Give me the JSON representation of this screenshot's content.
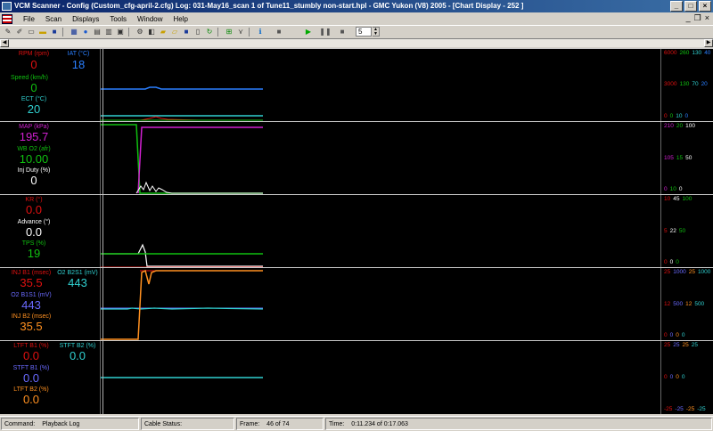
{
  "window": {
    "title": "VCM Scanner - Config (Custom_cfg-april-2.cfg) Log: 031-May16_scan 1 of Tune11_stumbly non-start.hpl - GMC Yukon (V8) 2005 - [Chart Display - 252 ]",
    "minimize": "_",
    "maximize": "□",
    "close": "×"
  },
  "menu": {
    "items": [
      "File",
      "Scan",
      "Displays",
      "Tools",
      "Window",
      "Help"
    ],
    "mdi_minimize": "_",
    "mdi_restore": "❐",
    "mdi_close": "×"
  },
  "toolbar": {
    "playback_speed": "5"
  },
  "panels": [
    {
      "id": "engine",
      "labels": [
        {
          "text": "RPM (rpm)",
          "color": "#e01010"
        },
        {
          "text": "IAT (°C)",
          "color": "#2a7fff"
        },
        {
          "text": "Speed (km/h)",
          "color": "#10c010"
        },
        {
          "text": "ECT (°C)",
          "color": "#30d0d0"
        }
      ],
      "values": [
        {
          "text": "0",
          "color": "#e01010"
        },
        {
          "text": "18",
          "color": "#2a7fff"
        },
        {
          "text": "0",
          "color": "#10c010"
        },
        {
          "text": "20",
          "color": "#30d0d0"
        }
      ],
      "scale": [
        [
          {
            "t": "6000",
            "c": "#e01010"
          },
          {
            "t": "260",
            "c": "#10c010"
          },
          {
            "t": "130",
            "c": "#30d0d0"
          },
          {
            "t": "40",
            "c": "#2a7fff"
          }
        ],
        [
          {
            "t": "3000",
            "c": "#e01010"
          },
          {
            "t": "130",
            "c": "#10c010"
          },
          {
            "t": "70",
            "c": "#30d0d0"
          },
          {
            "t": "20",
            "c": "#2a7fff"
          }
        ],
        [
          {
            "t": "0",
            "c": "#e01010"
          },
          {
            "t": "0",
            "c": "#10c010"
          },
          {
            "t": "10",
            "c": "#30d0d0"
          },
          {
            "t": "0",
            "c": "#2a7fff"
          }
        ]
      ]
    },
    {
      "id": "load",
      "labels": [
        {
          "text": "MAP (kPa)",
          "color": "#d020d0"
        },
        {
          "text": "WB O2 (afr)",
          "color": "#10c010"
        },
        {
          "text": "Inj Duty (%)",
          "color": "#ffffff"
        }
      ],
      "values": [
        {
          "text": "195.7",
          "color": "#d020d0"
        },
        {
          "text": "10.00",
          "color": "#10c010"
        },
        {
          "text": "0",
          "color": "#ffffff"
        }
      ],
      "scale": [
        [
          {
            "t": "210",
            "c": "#d020d0"
          },
          {
            "t": "20",
            "c": "#10c010"
          },
          {
            "t": "100",
            "c": "#ffffff"
          }
        ],
        [
          {
            "t": "105",
            "c": "#d020d0"
          },
          {
            "t": "15",
            "c": "#10c010"
          },
          {
            "t": "50",
            "c": "#ffffff"
          }
        ],
        [
          {
            "t": "0",
            "c": "#d020d0"
          },
          {
            "t": "10",
            "c": "#10c010"
          },
          {
            "t": "0",
            "c": "#ffffff"
          }
        ]
      ]
    },
    {
      "id": "spark",
      "labels": [
        {
          "text": "KR (°)",
          "color": "#e01010"
        },
        {
          "text": "Advance (°)",
          "color": "#ffffff"
        },
        {
          "text": "TPS (%)",
          "color": "#10c010"
        }
      ],
      "values": [
        {
          "text": "0.0",
          "color": "#e01010"
        },
        {
          "text": "0.0",
          "color": "#ffffff"
        },
        {
          "text": "19",
          "color": "#10c010"
        }
      ],
      "scale": [
        [
          {
            "t": "10",
            "c": "#e01010"
          },
          {
            "t": "45",
            "c": "#ffffff"
          },
          {
            "t": "100",
            "c": "#10c010"
          }
        ],
        [
          {
            "t": "5",
            "c": "#e01010"
          },
          {
            "t": "22",
            "c": "#ffffff"
          },
          {
            "t": "50",
            "c": "#10c010"
          }
        ],
        [
          {
            "t": "0",
            "c": "#e01010"
          },
          {
            "t": "0",
            "c": "#ffffff"
          },
          {
            "t": "0",
            "c": "#10c010"
          }
        ]
      ]
    },
    {
      "id": "injectors",
      "labels": [
        {
          "text": "INJ B1 (msec)",
          "color": "#e01010"
        },
        {
          "text": "O2 B2S1 (mV)",
          "color": "#30d0d0"
        },
        {
          "text": "O2 B1S1 (mV)",
          "color": "#6a6aff"
        },
        {
          "text": "INJ B2 (msec)",
          "color": "#ff9020"
        }
      ],
      "values": [
        {
          "text": "35.5",
          "color": "#e01010"
        },
        {
          "text": "443",
          "color": "#30d0d0"
        },
        {
          "text": "443",
          "color": "#6a6aff"
        },
        {
          "text": "35.5",
          "color": "#ff9020"
        }
      ],
      "scale": [
        [
          {
            "t": "25",
            "c": "#e01010"
          },
          {
            "t": "1000",
            "c": "#6a6aff"
          },
          {
            "t": "25",
            "c": "#ff9020"
          },
          {
            "t": "1000",
            "c": "#30d0d0"
          }
        ],
        [
          {
            "t": "12",
            "c": "#e01010"
          },
          {
            "t": "500",
            "c": "#6a6aff"
          },
          {
            "t": "12",
            "c": "#ff9020"
          },
          {
            "t": "500",
            "c": "#30d0d0"
          }
        ],
        [
          {
            "t": "0",
            "c": "#e01010"
          },
          {
            "t": "0",
            "c": "#6a6aff"
          },
          {
            "t": "0",
            "c": "#ff9020"
          },
          {
            "t": "0",
            "c": "#30d0d0"
          }
        ]
      ]
    },
    {
      "id": "fuel-trims",
      "labels": [
        {
          "text": "LTFT B1 (%)",
          "color": "#e01010"
        },
        {
          "text": "STFT B2 (%)",
          "color": "#30d0d0"
        },
        {
          "text": "STFT B1 (%)",
          "color": "#6a6aff"
        },
        {
          "text": "LTFT B2 (%)",
          "color": "#ff9020"
        }
      ],
      "values": [
        {
          "text": "0.0",
          "color": "#e01010"
        },
        {
          "text": "0.0",
          "color": "#30d0d0"
        },
        {
          "text": "0.0",
          "color": "#6a6aff"
        },
        {
          "text": "0.0",
          "color": "#ff9020"
        }
      ],
      "scale": [
        [
          {
            "t": "25",
            "c": "#e01010"
          },
          {
            "t": "25",
            "c": "#6a6aff"
          },
          {
            "t": "25",
            "c": "#ff9020"
          },
          {
            "t": "25",
            "c": "#30d0d0"
          }
        ],
        [
          {
            "t": "0",
            "c": "#e01010"
          },
          {
            "t": "0",
            "c": "#6a6aff"
          },
          {
            "t": "0",
            "c": "#ff9020"
          },
          {
            "t": "0",
            "c": "#30d0d0"
          }
        ],
        [
          {
            "t": "-25",
            "c": "#e01010"
          },
          {
            "t": "-25",
            "c": "#6a6aff"
          },
          {
            "t": "-25",
            "c": "#ff9020"
          },
          {
            "t": "-25",
            "c": "#30d0d0"
          }
        ]
      ]
    }
  ],
  "status": {
    "command_label": "Command:",
    "command_value": "Playback Log",
    "cable_label": "Cable Status:",
    "cable_value": "",
    "frame_label": "Frame:",
    "frame_value": "46 of 74",
    "time_label": "Time:",
    "time_value": "0:11.234 of 0:17.063"
  }
}
